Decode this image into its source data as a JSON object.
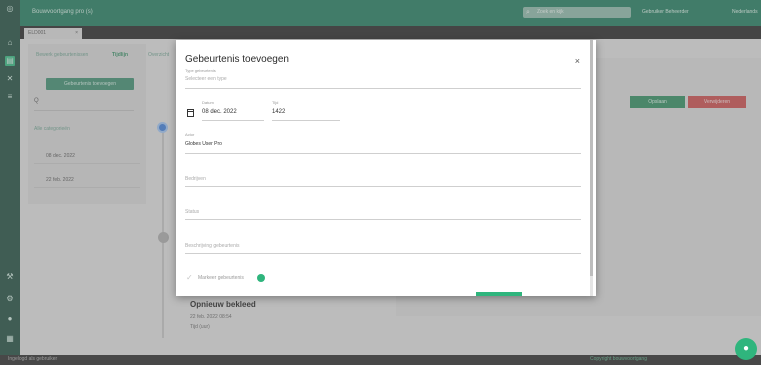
{
  "app": {
    "title": "Bouwvoortgang pro (s)",
    "search_placeholder": "Zoek en kijk",
    "user": "Gebruiker Beheerder",
    "language": "Nederlands"
  },
  "tabs": [
    {
      "label": "ELD001",
      "close": "×"
    }
  ],
  "left": {
    "subtabs": [
      "Bewerk gebeurtenissen",
      "Tijdlijn",
      "Overzicht"
    ],
    "add_button": "Gebeurtenis toevoegen",
    "search_value": "Q",
    "filter_label": "Alle categorieën",
    "dates": [
      "08 dec. 2022",
      "22 feb. 2022"
    ]
  },
  "right": {
    "button_primary": "Opslaan",
    "button_danger": "Verwijderen"
  },
  "event": {
    "title": "Opnieuw bekleed",
    "date": "22 feb. 2022 08:54",
    "sub": "Tijd (uur)"
  },
  "modal": {
    "title": "Gebeurtenis toevoegen",
    "close": "×",
    "type_label": "Type gebeurtenis",
    "type_placeholder": "Selecteer een type",
    "date_label": "Datum",
    "date_value": "08 dec. 2022",
    "time_label": "Tijd",
    "time_value": "1422",
    "actor_label": "Actor",
    "actor_value": "Globes User Pro",
    "field4_placeholder": "Bedrijven",
    "field5_placeholder": "Status",
    "field6_placeholder": "Beschrijving gebeurtenis",
    "checkbox_label": "Markeer gebeurtenis"
  },
  "footer": {
    "left": "Ingelogd als gebruiker",
    "right": "Copyright bouwvoortgang"
  },
  "colors": {
    "brand": "#1f7a5c",
    "accent": "#2fb57d",
    "danger": "#c84a4a",
    "timeline_blue": "#3c7bd6"
  },
  "icons": [
    "home-icon",
    "document-icon",
    "x-icon",
    "list-icon",
    "wrench-icon",
    "settings-icon",
    "user-icon",
    "grid-icon",
    "calendar-icon",
    "chat-icon"
  ]
}
